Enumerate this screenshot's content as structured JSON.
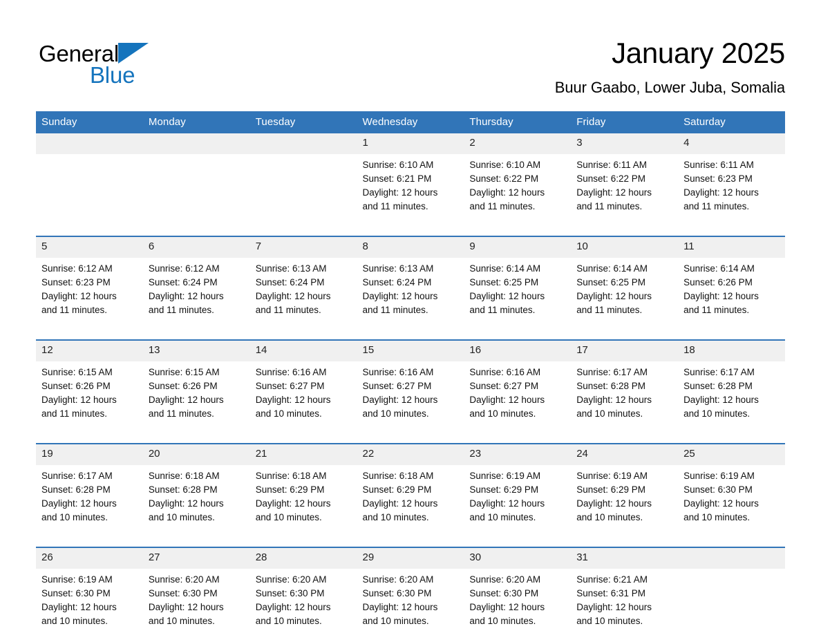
{
  "brand": {
    "name_part1": "General",
    "name_part2": "Blue",
    "triangle_color": "#1574bd"
  },
  "header": {
    "title": "January 2025",
    "subtitle": "Buur Gaabo, Lower Juba, Somalia"
  },
  "theme": {
    "header_blue": "#3175b8",
    "daynum_band": "#f0f0f0",
    "text": "#111111"
  },
  "weekday_headers": [
    "Sunday",
    "Monday",
    "Tuesday",
    "Wednesday",
    "Thursday",
    "Friday",
    "Saturday"
  ],
  "labels": {
    "sunrise_prefix": "Sunrise:",
    "sunset_prefix": "Sunset:",
    "daylight_prefix": "Daylight:"
  },
  "weeks": [
    {
      "days": [
        {
          "num": "",
          "empty": true
        },
        {
          "num": "",
          "empty": true
        },
        {
          "num": "",
          "empty": true
        },
        {
          "num": "1",
          "sunrise": "Sunrise: 6:10 AM",
          "sunset": "Sunset: 6:21 PM",
          "daylight_line1": "Daylight: 12 hours",
          "daylight_line2": "and 11 minutes."
        },
        {
          "num": "2",
          "sunrise": "Sunrise: 6:10 AM",
          "sunset": "Sunset: 6:22 PM",
          "daylight_line1": "Daylight: 12 hours",
          "daylight_line2": "and 11 minutes."
        },
        {
          "num": "3",
          "sunrise": "Sunrise: 6:11 AM",
          "sunset": "Sunset: 6:22 PM",
          "daylight_line1": "Daylight: 12 hours",
          "daylight_line2": "and 11 minutes."
        },
        {
          "num": "4",
          "sunrise": "Sunrise: 6:11 AM",
          "sunset": "Sunset: 6:23 PM",
          "daylight_line1": "Daylight: 12 hours",
          "daylight_line2": "and 11 minutes."
        }
      ]
    },
    {
      "days": [
        {
          "num": "5",
          "sunrise": "Sunrise: 6:12 AM",
          "sunset": "Sunset: 6:23 PM",
          "daylight_line1": "Daylight: 12 hours",
          "daylight_line2": "and 11 minutes."
        },
        {
          "num": "6",
          "sunrise": "Sunrise: 6:12 AM",
          "sunset": "Sunset: 6:24 PM",
          "daylight_line1": "Daylight: 12 hours",
          "daylight_line2": "and 11 minutes."
        },
        {
          "num": "7",
          "sunrise": "Sunrise: 6:13 AM",
          "sunset": "Sunset: 6:24 PM",
          "daylight_line1": "Daylight: 12 hours",
          "daylight_line2": "and 11 minutes."
        },
        {
          "num": "8",
          "sunrise": "Sunrise: 6:13 AM",
          "sunset": "Sunset: 6:24 PM",
          "daylight_line1": "Daylight: 12 hours",
          "daylight_line2": "and 11 minutes."
        },
        {
          "num": "9",
          "sunrise": "Sunrise: 6:14 AM",
          "sunset": "Sunset: 6:25 PM",
          "daylight_line1": "Daylight: 12 hours",
          "daylight_line2": "and 11 minutes."
        },
        {
          "num": "10",
          "sunrise": "Sunrise: 6:14 AM",
          "sunset": "Sunset: 6:25 PM",
          "daylight_line1": "Daylight: 12 hours",
          "daylight_line2": "and 11 minutes."
        },
        {
          "num": "11",
          "sunrise": "Sunrise: 6:14 AM",
          "sunset": "Sunset: 6:26 PM",
          "daylight_line1": "Daylight: 12 hours",
          "daylight_line2": "and 11 minutes."
        }
      ]
    },
    {
      "days": [
        {
          "num": "12",
          "sunrise": "Sunrise: 6:15 AM",
          "sunset": "Sunset: 6:26 PM",
          "daylight_line1": "Daylight: 12 hours",
          "daylight_line2": "and 11 minutes."
        },
        {
          "num": "13",
          "sunrise": "Sunrise: 6:15 AM",
          "sunset": "Sunset: 6:26 PM",
          "daylight_line1": "Daylight: 12 hours",
          "daylight_line2": "and 11 minutes."
        },
        {
          "num": "14",
          "sunrise": "Sunrise: 6:16 AM",
          "sunset": "Sunset: 6:27 PM",
          "daylight_line1": "Daylight: 12 hours",
          "daylight_line2": "and 10 minutes."
        },
        {
          "num": "15",
          "sunrise": "Sunrise: 6:16 AM",
          "sunset": "Sunset: 6:27 PM",
          "daylight_line1": "Daylight: 12 hours",
          "daylight_line2": "and 10 minutes."
        },
        {
          "num": "16",
          "sunrise": "Sunrise: 6:16 AM",
          "sunset": "Sunset: 6:27 PM",
          "daylight_line1": "Daylight: 12 hours",
          "daylight_line2": "and 10 minutes."
        },
        {
          "num": "17",
          "sunrise": "Sunrise: 6:17 AM",
          "sunset": "Sunset: 6:28 PM",
          "daylight_line1": "Daylight: 12 hours",
          "daylight_line2": "and 10 minutes."
        },
        {
          "num": "18",
          "sunrise": "Sunrise: 6:17 AM",
          "sunset": "Sunset: 6:28 PM",
          "daylight_line1": "Daylight: 12 hours",
          "daylight_line2": "and 10 minutes."
        }
      ]
    },
    {
      "days": [
        {
          "num": "19",
          "sunrise": "Sunrise: 6:17 AM",
          "sunset": "Sunset: 6:28 PM",
          "daylight_line1": "Daylight: 12 hours",
          "daylight_line2": "and 10 minutes."
        },
        {
          "num": "20",
          "sunrise": "Sunrise: 6:18 AM",
          "sunset": "Sunset: 6:28 PM",
          "daylight_line1": "Daylight: 12 hours",
          "daylight_line2": "and 10 minutes."
        },
        {
          "num": "21",
          "sunrise": "Sunrise: 6:18 AM",
          "sunset": "Sunset: 6:29 PM",
          "daylight_line1": "Daylight: 12 hours",
          "daylight_line2": "and 10 minutes."
        },
        {
          "num": "22",
          "sunrise": "Sunrise: 6:18 AM",
          "sunset": "Sunset: 6:29 PM",
          "daylight_line1": "Daylight: 12 hours",
          "daylight_line2": "and 10 minutes."
        },
        {
          "num": "23",
          "sunrise": "Sunrise: 6:19 AM",
          "sunset": "Sunset: 6:29 PM",
          "daylight_line1": "Daylight: 12 hours",
          "daylight_line2": "and 10 minutes."
        },
        {
          "num": "24",
          "sunrise": "Sunrise: 6:19 AM",
          "sunset": "Sunset: 6:29 PM",
          "daylight_line1": "Daylight: 12 hours",
          "daylight_line2": "and 10 minutes."
        },
        {
          "num": "25",
          "sunrise": "Sunrise: 6:19 AM",
          "sunset": "Sunset: 6:30 PM",
          "daylight_line1": "Daylight: 12 hours",
          "daylight_line2": "and 10 minutes."
        }
      ]
    },
    {
      "days": [
        {
          "num": "26",
          "sunrise": "Sunrise: 6:19 AM",
          "sunset": "Sunset: 6:30 PM",
          "daylight_line1": "Daylight: 12 hours",
          "daylight_line2": "and 10 minutes."
        },
        {
          "num": "27",
          "sunrise": "Sunrise: 6:20 AM",
          "sunset": "Sunset: 6:30 PM",
          "daylight_line1": "Daylight: 12 hours",
          "daylight_line2": "and 10 minutes."
        },
        {
          "num": "28",
          "sunrise": "Sunrise: 6:20 AM",
          "sunset": "Sunset: 6:30 PM",
          "daylight_line1": "Daylight: 12 hours",
          "daylight_line2": "and 10 minutes."
        },
        {
          "num": "29",
          "sunrise": "Sunrise: 6:20 AM",
          "sunset": "Sunset: 6:30 PM",
          "daylight_line1": "Daylight: 12 hours",
          "daylight_line2": "and 10 minutes."
        },
        {
          "num": "30",
          "sunrise": "Sunrise: 6:20 AM",
          "sunset": "Sunset: 6:30 PM",
          "daylight_line1": "Daylight: 12 hours",
          "daylight_line2": "and 10 minutes."
        },
        {
          "num": "31",
          "sunrise": "Sunrise: 6:21 AM",
          "sunset": "Sunset: 6:31 PM",
          "daylight_line1": "Daylight: 12 hours",
          "daylight_line2": "and 10 minutes."
        },
        {
          "num": "",
          "empty": true
        }
      ]
    }
  ]
}
